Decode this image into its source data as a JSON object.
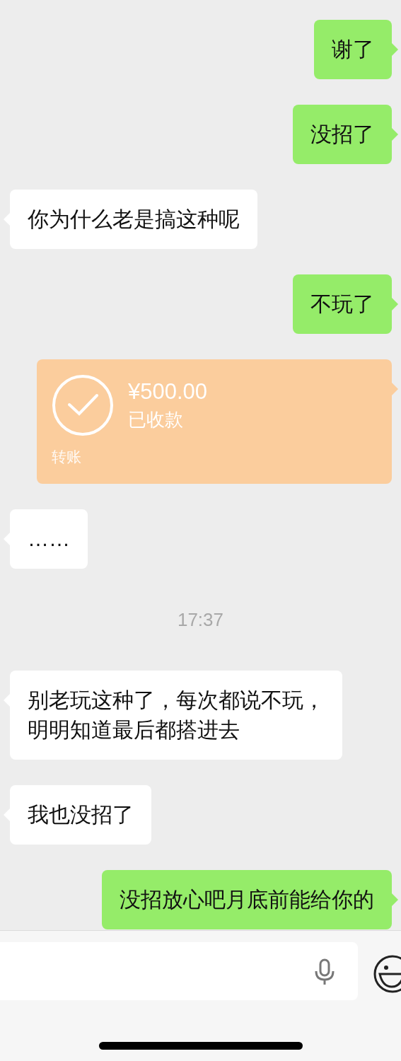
{
  "messages": [
    {
      "kind": "text",
      "outgoing": true,
      "lines": [
        "谢了"
      ]
    },
    {
      "kind": "text",
      "outgoing": true,
      "lines": [
        "没招了"
      ]
    },
    {
      "kind": "text",
      "outgoing": false,
      "lines": [
        "你为什么老是搞这种呢"
      ]
    },
    {
      "kind": "text",
      "outgoing": true,
      "lines": [
        "不玩了"
      ]
    },
    {
      "kind": "transfer",
      "outgoing": true,
      "amount": "¥500.00",
      "status": "已收款",
      "label": "转账"
    },
    {
      "kind": "text",
      "outgoing": false,
      "lines": [
        "……"
      ]
    },
    {
      "kind": "time",
      "text": "17:37"
    },
    {
      "kind": "text",
      "outgoing": false,
      "lines": [
        "别老玩这种了，每次都说不玩，",
        "明明知道最后都搭进去"
      ]
    },
    {
      "kind": "text",
      "outgoing": false,
      "lines": [
        "我也没招了"
      ]
    },
    {
      "kind": "text",
      "outgoing": true,
      "lines": [
        "没招放心吧月底前能给你的"
      ]
    }
  ]
}
